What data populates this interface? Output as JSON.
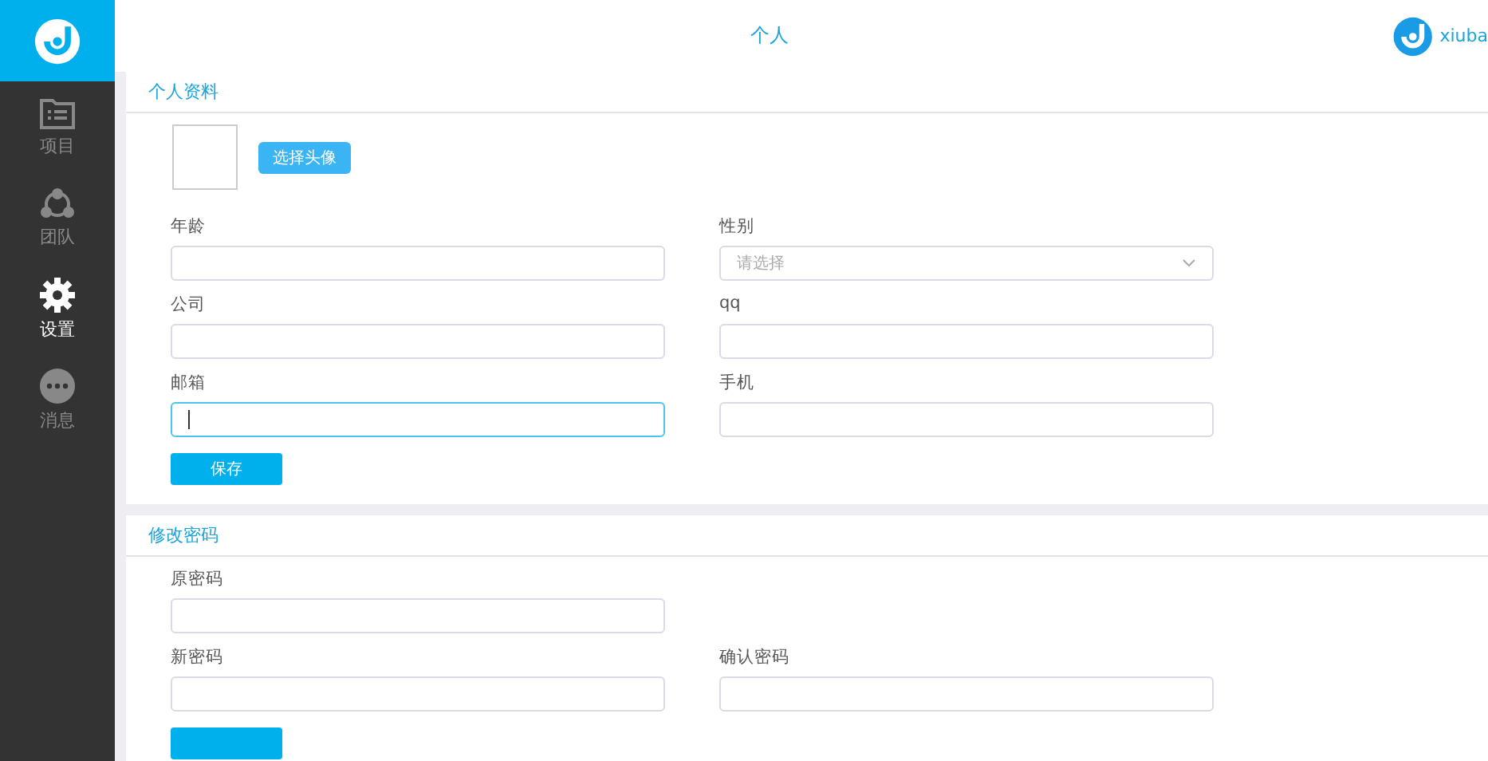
{
  "sidebar": {
    "items": [
      {
        "label": "项目",
        "selected": false
      },
      {
        "label": "团队",
        "selected": false
      },
      {
        "label": "设置",
        "selected": true
      },
      {
        "label": "消息",
        "selected": false
      }
    ]
  },
  "header": {
    "title": "个人",
    "username": "xiuba"
  },
  "sections": [
    {
      "title": "个人资料",
      "avatar": {
        "button": "选择头像"
      },
      "fields": [
        {
          "label": "年龄",
          "kind": "input",
          "focused": false
        },
        {
          "label": "性别",
          "kind": "select",
          "placeholder": "请选择",
          "focused": false
        },
        {
          "label": "公司",
          "kind": "input",
          "focused": false
        },
        {
          "label": "qq",
          "kind": "input",
          "focused": false
        },
        {
          "label": "邮箱",
          "kind": "input",
          "focused": true
        },
        {
          "label": "手机",
          "kind": "input",
          "focused": false
        }
      ],
      "submit": {
        "label": "保存"
      }
    },
    {
      "title": "修改密码",
      "fields": [
        {
          "label": "原密码",
          "kind": "input",
          "focused": false
        },
        {
          "kind": "spacer"
        },
        {
          "label": "新密码",
          "kind": "input",
          "focused": false
        },
        {
          "label": "确认密码",
          "kind": "input",
          "focused": false
        }
      ],
      "submit_partly_hidden": true
    }
  ]
}
